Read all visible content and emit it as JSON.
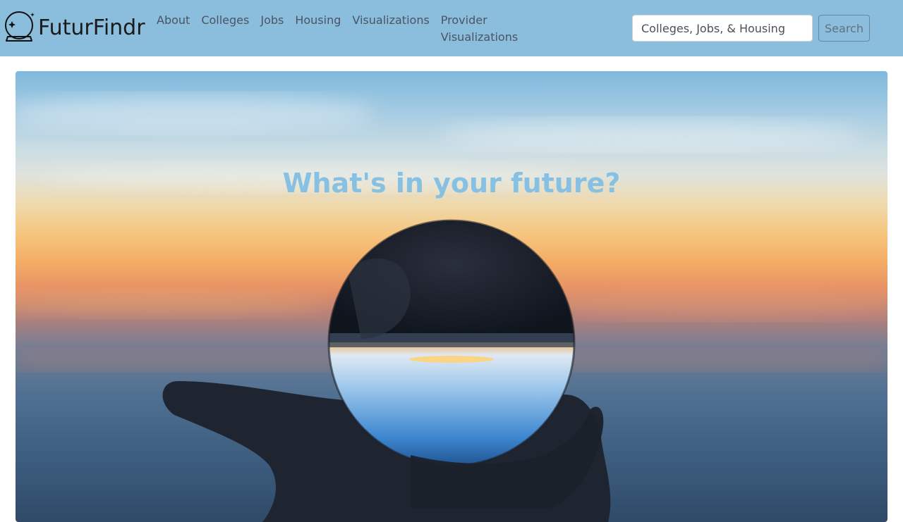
{
  "brand": {
    "name": "FuturFindr",
    "icon": "crystal-ball-icon"
  },
  "nav": {
    "items": [
      {
        "label": "About"
      },
      {
        "label": "Colleges"
      },
      {
        "label": "Jobs"
      },
      {
        "label": "Housing"
      },
      {
        "label": "Visualizations"
      },
      {
        "label": "Provider Visualizations"
      }
    ]
  },
  "search": {
    "placeholder": "Colleges, Jobs, & Housing",
    "button_label": "Search"
  },
  "hero": {
    "title": "What's in your future?",
    "image": "hand-holding-crystal-ball-at-sunset"
  },
  "colors": {
    "navbar": "#8bbddd",
    "hero_title": "#86c0e2"
  }
}
